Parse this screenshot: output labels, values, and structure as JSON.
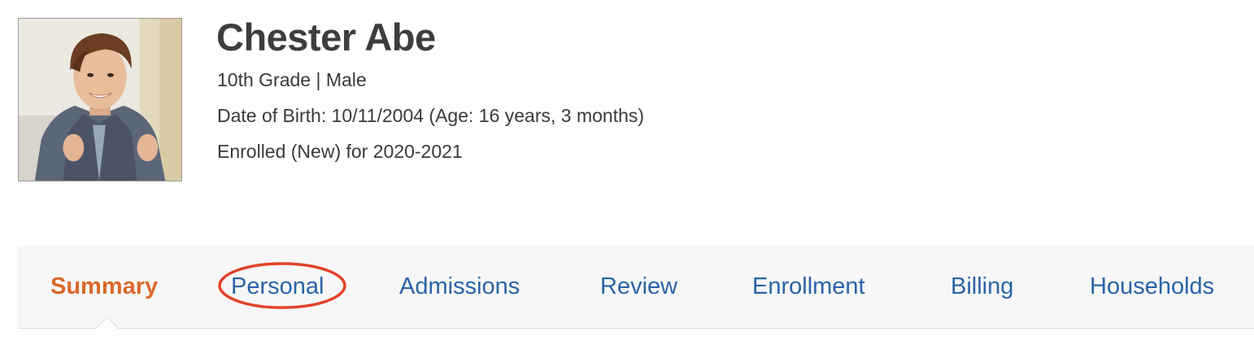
{
  "student": {
    "name": "Chester Abe",
    "grade_gender": "10th Grade | Male",
    "date_of_birth": "Date of Birth: 10/11/2004 (Age: 16 years, 3 months)",
    "enrollment_status": "Enrolled (New) for 2020-2021"
  },
  "tabs": [
    {
      "label": "Summary",
      "active": true
    },
    {
      "label": "Personal",
      "active": false
    },
    {
      "label": "Admissions",
      "active": false
    },
    {
      "label": "Review",
      "active": false
    },
    {
      "label": "Enrollment",
      "active": false
    },
    {
      "label": "Billing",
      "active": false
    },
    {
      "label": "Households",
      "active": false
    }
  ],
  "annotation": {
    "circled_tab": "Personal",
    "color": "#e0432b"
  },
  "colors": {
    "active_tab": "#d9692a",
    "inactive_tab": "#2a63a8",
    "tab_bar_bg": "#f7f7f7"
  }
}
